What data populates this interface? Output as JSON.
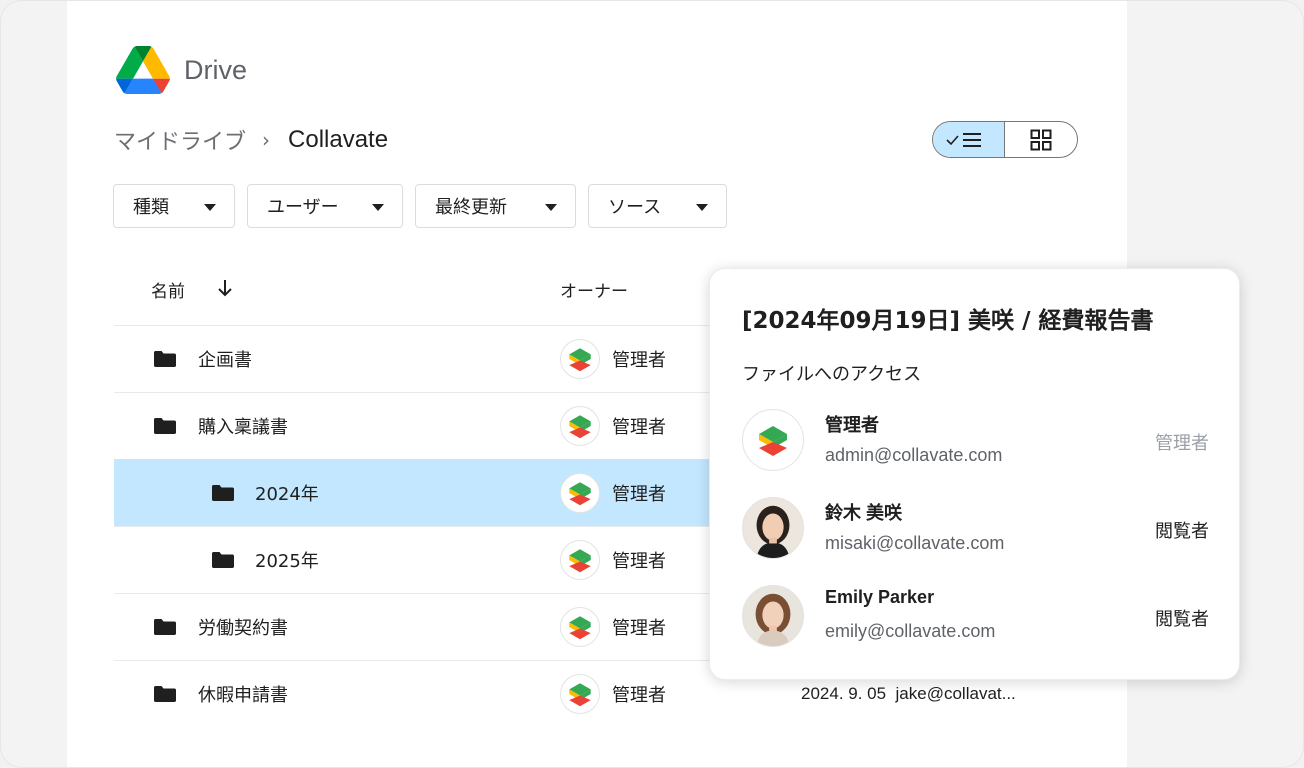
{
  "app": {
    "name": "Drive"
  },
  "breadcrumb": {
    "root": "マイドライブ",
    "separator": "›",
    "current": "Collavate"
  },
  "filters": [
    {
      "label": "種類"
    },
    {
      "label": "ユーザー"
    },
    {
      "label": "最終更新"
    },
    {
      "label": "ソース"
    }
  ],
  "table": {
    "headers": {
      "name": "名前",
      "owner": "オーナー"
    },
    "rows": [
      {
        "name": "企画書",
        "owner": "管理者",
        "selected": false,
        "indent": 0
      },
      {
        "name": "購入稟議書",
        "owner": "管理者",
        "selected": false,
        "indent": 0
      },
      {
        "name": "2024年",
        "owner": "管理者",
        "selected": true,
        "indent": 1
      },
      {
        "name": "2025年",
        "owner": "管理者",
        "selected": false,
        "indent": 1
      },
      {
        "name": "労働契約書",
        "owner": "管理者",
        "selected": false,
        "indent": 0
      },
      {
        "name": "休暇申請書",
        "owner": "管理者",
        "selected": false,
        "indent": 0,
        "modified": "2024. 9. 05",
        "modified_by": "jake@collavat..."
      }
    ]
  },
  "popover": {
    "title": "[2024年09月19日] 美咲 / 経費報告書",
    "subtitle": "ファイルへのアクセス",
    "people": [
      {
        "name": "管理者",
        "email": "admin@collavate.com",
        "role": "管理者",
        "role_muted": true
      },
      {
        "name": "鈴木 美咲",
        "email": "misaki@collavate.com",
        "role": "閲覧者",
        "role_muted": false
      },
      {
        "name": "Emily Parker",
        "email": "emily@collavate.com",
        "role": "閲覧者",
        "role_muted": false
      }
    ]
  },
  "colors": {
    "selected_row": "#c2e7ff",
    "toggle_active": "#c2e7ff",
    "logo_green": "#34a853",
    "logo_yellow": "#fbbc04",
    "logo_red": "#ea4335"
  }
}
